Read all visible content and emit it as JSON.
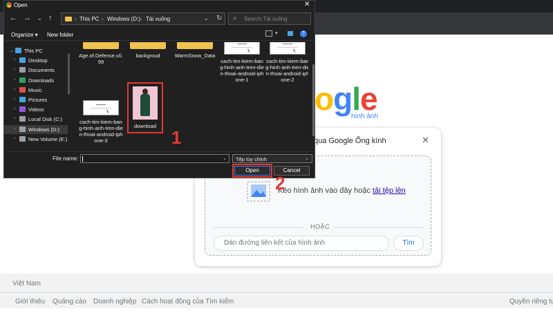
{
  "google": {
    "logo_letters": [
      {
        "ch": "o",
        "color": "#fbbc05"
      },
      {
        "ch": "g",
        "color": "#4285f4"
      },
      {
        "ch": "l",
        "color": "#34a853"
      },
      {
        "ch": "e",
        "color": "#ea4335"
      }
    ],
    "logo_sub": "hình ảnh",
    "lens_title": "qua Google Ống kính",
    "drop_text": "Kéo hình ảnh vào đây hoặc ",
    "drop_link": "tải tệp lên",
    "or_label": "HOẶC",
    "url_placeholder": "Dán đường liên kết của hình ảnh",
    "search_button": "Tìm",
    "footer_country": "Việt Nam",
    "footer_links": [
      "Giới thiệu",
      "Quảng cáo",
      "Doanh nghiệp",
      "Cách hoạt động của Tìm kiếm"
    ],
    "footer_right": "Quyền riêng tư"
  },
  "dialog": {
    "title": "Open",
    "breadcrumbs": [
      "This PC",
      "Windows (D:)",
      "Tải xuống"
    ],
    "search_placeholder": "Search Tải xuống",
    "organize_label": "Organize ▾",
    "new_folder_label": "New folder",
    "sidebar": [
      {
        "label": "This PC",
        "icon": "monitor-icon",
        "color": "#4aa3df",
        "level": 0,
        "expanded": true,
        "selected": false
      },
      {
        "label": "Desktop",
        "icon": "desktop-icon",
        "color": "#4aa3df",
        "level": 1,
        "selected": false
      },
      {
        "label": "Documents",
        "icon": "documents-icon",
        "color": "#9aa0a6",
        "level": 1,
        "selected": false
      },
      {
        "label": "Downloads",
        "icon": "downloads-icon",
        "color": "#2e9e5b",
        "level": 1,
        "selected": false
      },
      {
        "label": "Music",
        "icon": "music-icon",
        "color": "#e0524a",
        "level": 1,
        "selected": false
      },
      {
        "label": "Pictures",
        "icon": "pictures-icon",
        "color": "#4aa3df",
        "level": 1,
        "selected": false
      },
      {
        "label": "Videos",
        "icon": "videos-icon",
        "color": "#8e5bd6",
        "level": 1,
        "selected": false
      },
      {
        "label": "Local Disk (C:)",
        "icon": "drive-icon",
        "color": "#9aa0a6",
        "level": 1,
        "selected": false
      },
      {
        "label": "Windows (D:)",
        "icon": "drive-icon",
        "color": "#9aa0a6",
        "level": 1,
        "selected": true
      },
      {
        "label": "New Volume (E:)",
        "icon": "drive-icon",
        "color": "#9aa0a6",
        "level": 1,
        "selected": false
      }
    ],
    "files": [
      {
        "name": "Age.of.Defense.v0.99",
        "type": "folder"
      },
      {
        "name": "backgroud",
        "type": "folder"
      },
      {
        "name": "WarmSnow_Data",
        "type": "folder"
      },
      {
        "name": "cach-tim-kiem-bang-hinh-anh-tren-dien-thoai-android-iphone-1",
        "type": "image"
      },
      {
        "name": "cach-tim-kiem-bang-hinh-anh-tren-dien-thoai-android-iphone-2",
        "type": "image"
      },
      {
        "name": "cach-tim-kiem-bang-hinh-anh-tren-dien-thoai-android-iphone-3",
        "type": "image"
      },
      {
        "name": "download",
        "type": "photo",
        "selected": true
      }
    ],
    "file_name_label": "File name:",
    "file_name_value": "",
    "file_type": "Tệp tùy chỉnh",
    "open_button": "Open",
    "cancel_button": "Cancel"
  },
  "annotations": {
    "step1": "1",
    "step2": "2",
    "color": "#e53935"
  }
}
